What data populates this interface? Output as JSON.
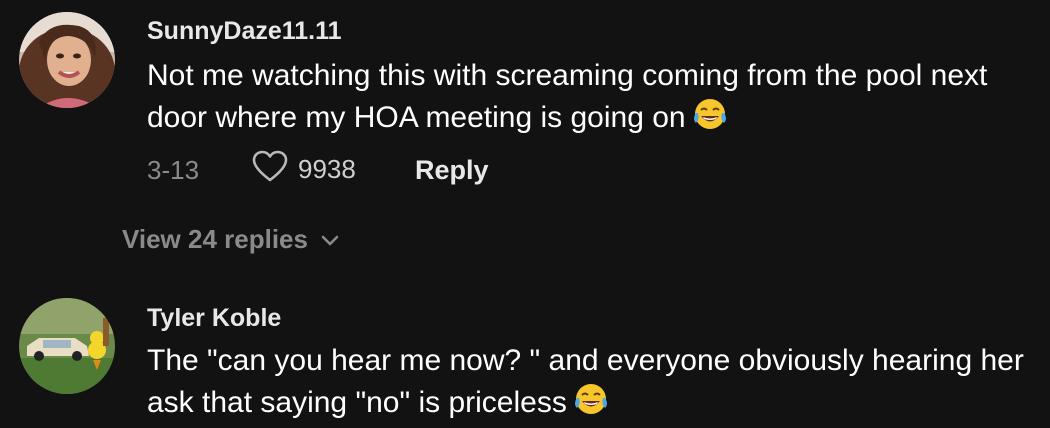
{
  "comments": [
    {
      "username": "SunnyDaze11.11",
      "text": "Not me watching this with screaming coming from the pool next door where my HOA meeting is going on",
      "emoji": "laughing-tears",
      "date": "3-13",
      "likes": "9938",
      "reply_label": "Reply",
      "view_replies": "View 24 replies"
    },
    {
      "username": "Tyler Koble",
      "text": "The \"can you hear me now? \" and everyone obviously hearing her ask that saying \"no\" is priceless",
      "emoji": "laughing-tears"
    }
  ],
  "colors": {
    "background": "#121212",
    "primary_text": "#ffffff",
    "secondary_text": "#8a8a8a"
  }
}
